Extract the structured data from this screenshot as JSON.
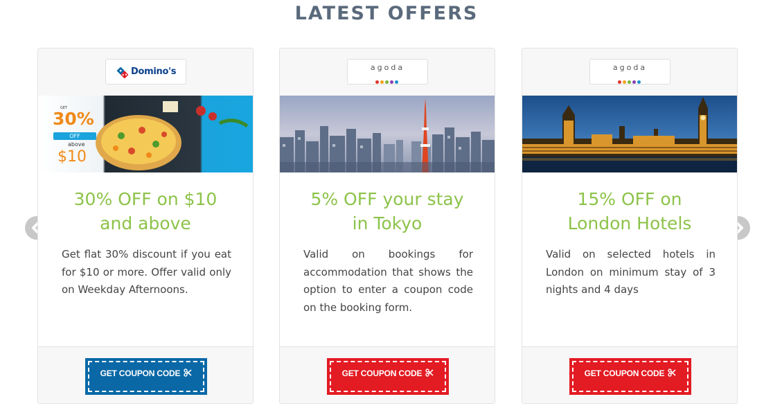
{
  "section": {
    "title": "LATEST OFFERS"
  },
  "navigation": {
    "prev_icon": "chevron-left-icon",
    "next_icon": "chevron-right-icon"
  },
  "offers": [
    {
      "brand": "Domino's",
      "image_text": {
        "small": "GET",
        "percent": "30%",
        "off": "OFF",
        "above": "above",
        "amount": "$10"
      },
      "title_line1": "30% OFF on $10",
      "title_line2": "and above",
      "description": "Get flat 30% discount if you eat for $10 or more. Offer valid only on Weekday Afternoons.",
      "button_label": "GET COUPON CODE",
      "button_color": "#0a68a6"
    },
    {
      "brand": "agoda",
      "title_line1": "5% OFF your stay",
      "title_line2": "in Tokyo",
      "description": "Valid on bookings for accommodation that shows the option to enter a coupon code on the booking form.",
      "button_label": "GET COUPON CODE",
      "button_color": "#e31b23"
    },
    {
      "brand": "agoda",
      "title_line1": "15% OFF on",
      "title_line2": "London Hotels",
      "description": "Valid on selected hotels in London on minimum stay of 3 nights and 4 days",
      "button_label": "GET COUPON CODE",
      "button_color": "#e31b23"
    }
  ],
  "colors": {
    "title": "#5a6a7c",
    "offer_title": "#8dc34a",
    "agoda_dots": [
      "#e0332c",
      "#f3a01b",
      "#7bb53a",
      "#8a3fb0",
      "#1e8fd0"
    ]
  }
}
